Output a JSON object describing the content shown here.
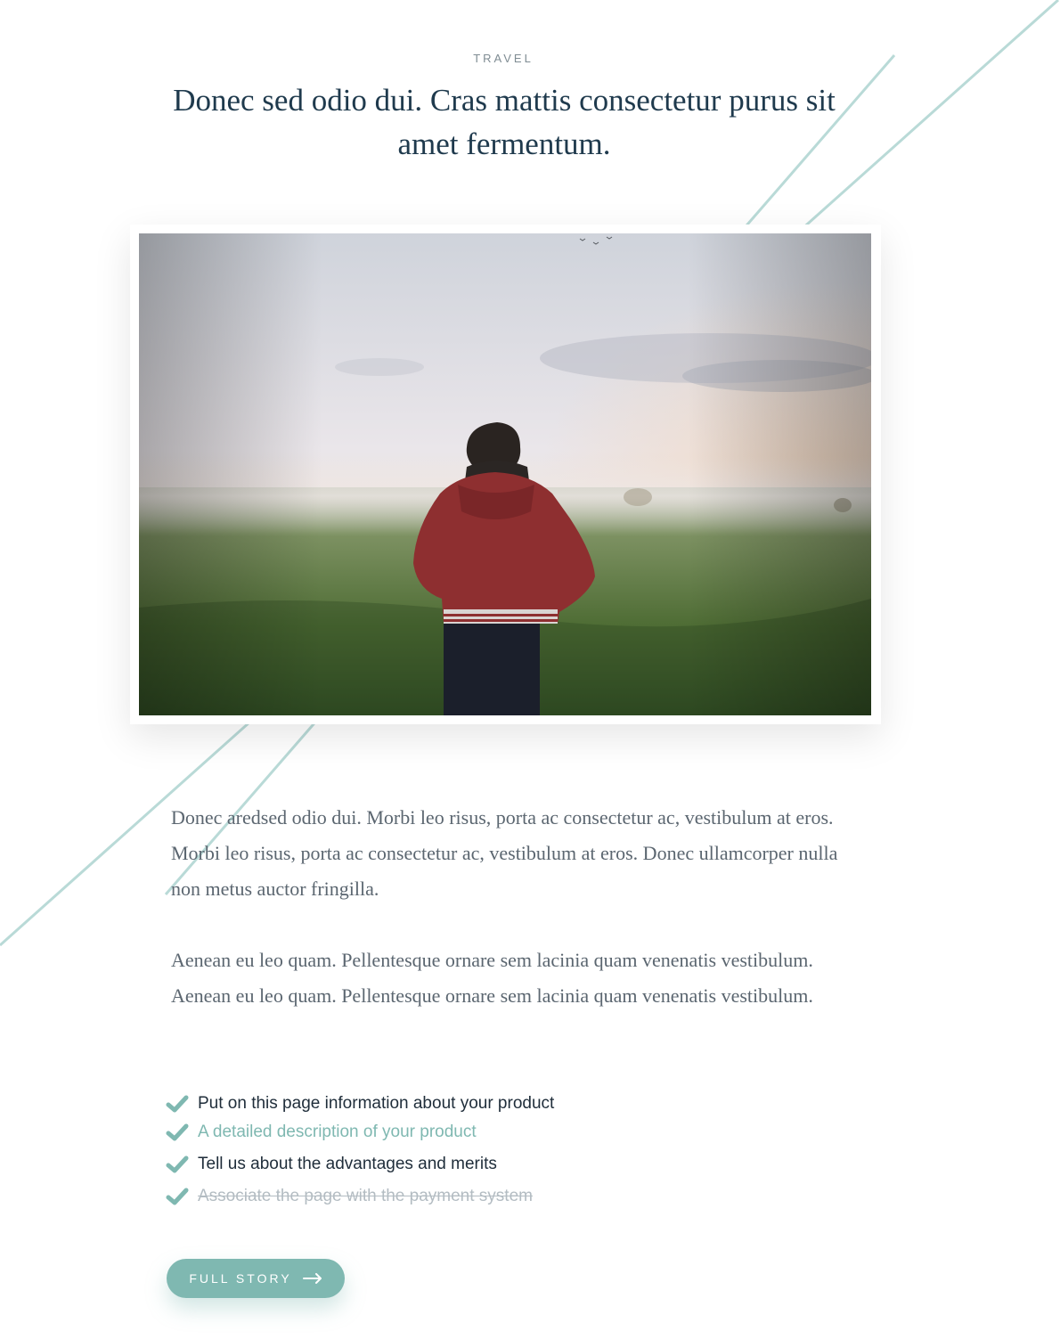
{
  "category": "TRAVEL",
  "title": "Donec sed odio dui. Cras mattis consectetur purus sit amet fermentum.",
  "hero_image": {
    "alt": ""
  },
  "paragraphs": [
    "Donec aredsed odio dui. Morbi leo risus, porta ac consectetur ac, vestibulum at eros. Morbi leo risus, porta ac consectetur ac, vestibulum at eros. Donec ullamcorper nulla non metus auctor fringilla.",
    "Aenean eu leo quam. Pellentesque ornare sem lacinia quam venenatis vestibulum. Aenean eu leo quam. Pellentesque ornare sem lacinia quam venenatis vestibulum."
  ],
  "checklist": [
    {
      "label": "Put on this page information about your product",
      "icon": "check-icon",
      "state": "normal"
    },
    {
      "label": "A detailed description of your product",
      "icon": "check-icon",
      "state": "highlighted"
    },
    {
      "label": "Tell us about the advantages and merits",
      "icon": "check-icon",
      "state": "normal"
    },
    {
      "label": "Associate the page with the payment system",
      "icon": "check-icon",
      "state": "struck-through"
    }
  ],
  "cta": {
    "label": "FULL STORY",
    "icon": "arrow-right-icon"
  },
  "colors": {
    "accent": "#7fb8b1",
    "title": "#1f3a4d",
    "body": "#5b6670",
    "muted": "#b3bcc2",
    "decor_line": "#b9dad7"
  }
}
